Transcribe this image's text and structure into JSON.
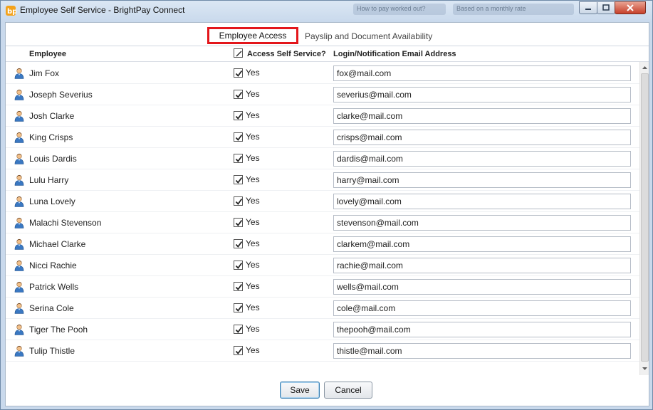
{
  "window": {
    "title": "Employee Self Service - BrightPay Connect",
    "background_hint_1": "How to pay worked out?",
    "background_hint_2": "Based on a monthly rate"
  },
  "tabs": [
    {
      "label": "Employee Access",
      "active": true
    },
    {
      "label": "Payslip and Document Availability",
      "active": false
    }
  ],
  "columns": {
    "employee": "Employee",
    "access": "Access Self Service?",
    "email": "Login/Notification Email Address"
  },
  "rows": [
    {
      "name": "Jim Fox",
      "access": "Yes",
      "email": "fox@mail.com"
    },
    {
      "name": "Joseph Severius",
      "access": "Yes",
      "email": "severius@mail.com"
    },
    {
      "name": "Josh Clarke",
      "access": "Yes",
      "email": "clarke@mail.com"
    },
    {
      "name": "King Crisps",
      "access": "Yes",
      "email": "crisps@mail.com"
    },
    {
      "name": "Louis Dardis",
      "access": "Yes",
      "email": "dardis@mail.com"
    },
    {
      "name": "Lulu Harry",
      "access": "Yes",
      "email": "harry@mail.com"
    },
    {
      "name": "Luna Lovely",
      "access": "Yes",
      "email": "lovely@mail.com"
    },
    {
      "name": "Malachi Stevenson",
      "access": "Yes",
      "email": "stevenson@mail.com"
    },
    {
      "name": "Michael Clarke",
      "access": "Yes",
      "email": "clarkem@mail.com"
    },
    {
      "name": "Nicci Rachie",
      "access": "Yes",
      "email": "rachie@mail.com"
    },
    {
      "name": "Patrick Wells",
      "access": "Yes",
      "email": "wells@mail.com"
    },
    {
      "name": "Serina Cole",
      "access": "Yes",
      "email": "cole@mail.com"
    },
    {
      "name": "Tiger The Pooh",
      "access": "Yes",
      "email": "thepooh@mail.com"
    },
    {
      "name": "Tulip Thistle",
      "access": "Yes",
      "email": "thistle@mail.com"
    }
  ],
  "buttons": {
    "save": "Save",
    "cancel": "Cancel"
  },
  "colors": {
    "highlight": "#e3161b",
    "accent": "#3c7fb1"
  },
  "icons": {
    "app": "brightpay-logo-icon",
    "row": "person-icon",
    "check": "checkmark-icon"
  }
}
